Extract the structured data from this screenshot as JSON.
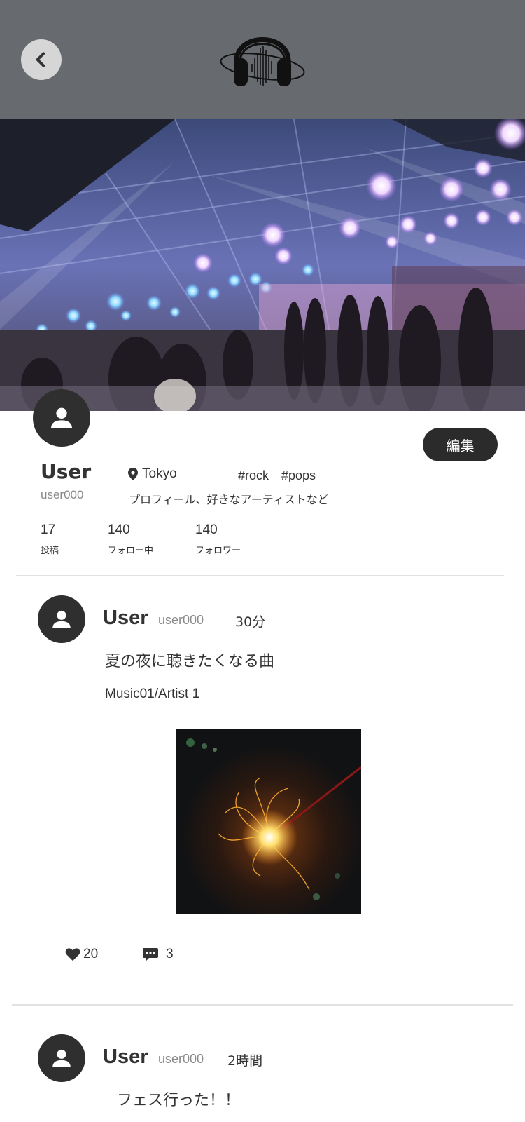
{
  "header": {
    "back_icon": "chevron-left-icon",
    "logo_icon": "headphones-logo-icon",
    "bg_color": "#676a6e"
  },
  "profile": {
    "name": "User",
    "handle": "user000",
    "location": "Tokyo",
    "tags": [
      "#rock",
      "#pops"
    ],
    "bio": "プロフィール、好きなアーティストなど",
    "edit_label": "編集",
    "stats": [
      {
        "value": "17",
        "label": "投稿"
      },
      {
        "value": "140",
        "label": "フォロー中"
      },
      {
        "value": "140",
        "label": "フォロワー"
      }
    ]
  },
  "posts": [
    {
      "name": "User",
      "handle": "user000",
      "time": "30分",
      "text": "夏の夜に聴きたくなる曲",
      "music": "Music01/Artist 1",
      "likes": "20",
      "comments": "3"
    },
    {
      "name": "User",
      "handle": "user000",
      "time": "2時間",
      "text": "フェス行った！！"
    }
  ]
}
